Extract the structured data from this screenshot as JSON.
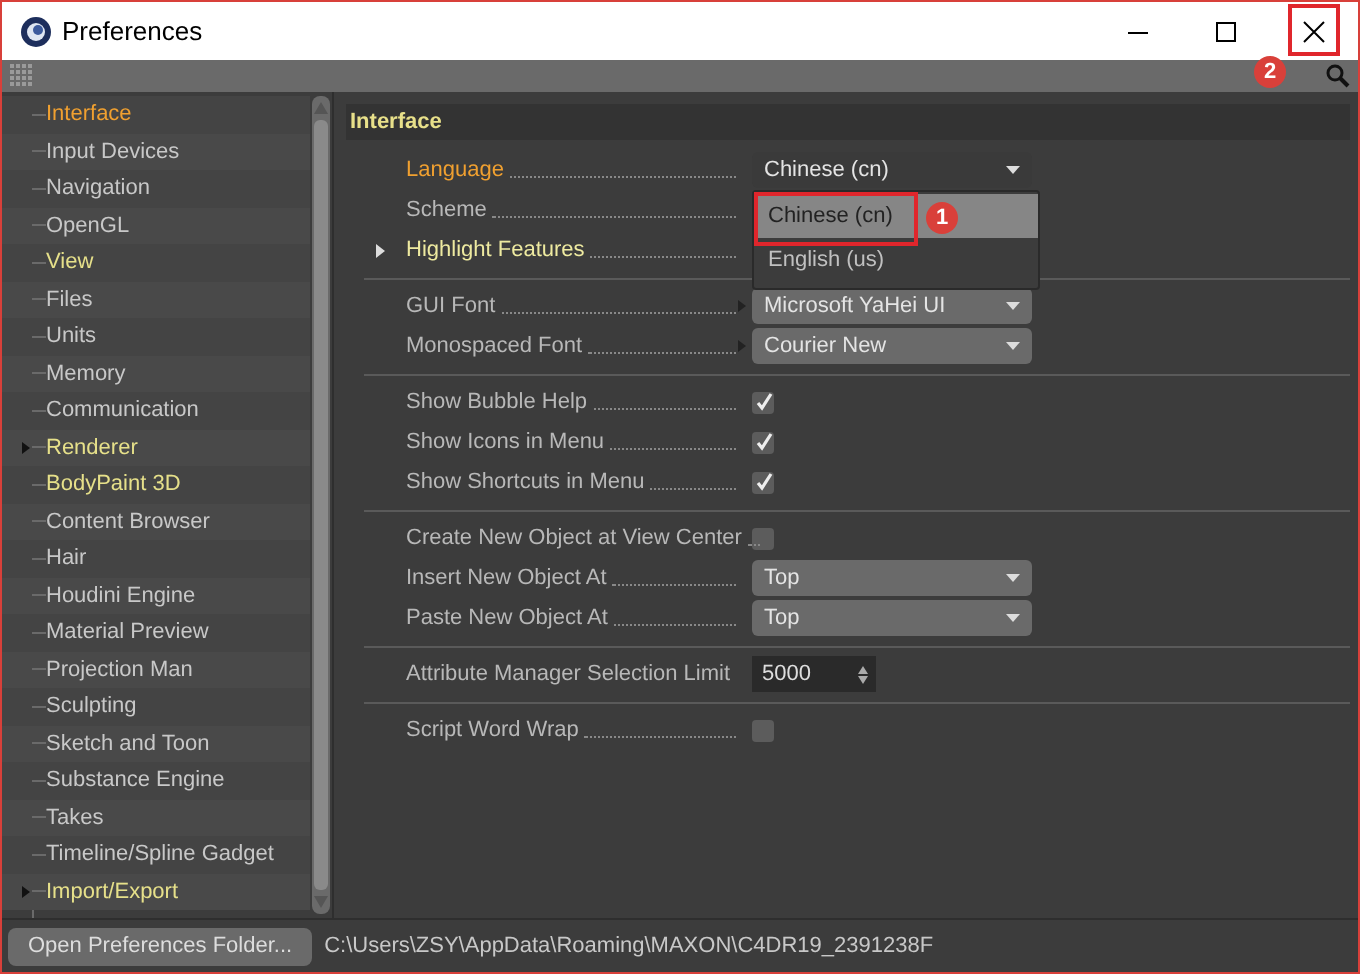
{
  "window": {
    "title": "Preferences"
  },
  "sidebar": {
    "items": [
      {
        "label": "Interface",
        "selected": true,
        "highlighted": false
      },
      {
        "label": "Input Devices",
        "selected": false,
        "highlighted": false
      },
      {
        "label": "Navigation",
        "selected": false,
        "highlighted": false
      },
      {
        "label": "OpenGL",
        "selected": false,
        "highlighted": false
      },
      {
        "label": "View",
        "selected": false,
        "highlighted": true
      },
      {
        "label": "Files",
        "selected": false,
        "highlighted": false
      },
      {
        "label": "Units",
        "selected": false,
        "highlighted": false
      },
      {
        "label": "Memory",
        "selected": false,
        "highlighted": false
      },
      {
        "label": "Communication",
        "selected": false,
        "highlighted": false
      },
      {
        "label": "Renderer",
        "selected": false,
        "highlighted": true,
        "expanded": false
      },
      {
        "label": "BodyPaint 3D",
        "selected": false,
        "highlighted": true
      },
      {
        "label": "Content Browser",
        "selected": false,
        "highlighted": false
      },
      {
        "label": "Hair",
        "selected": false,
        "highlighted": false
      },
      {
        "label": "Houdini Engine",
        "selected": false,
        "highlighted": false
      },
      {
        "label": "Material Preview",
        "selected": false,
        "highlighted": false
      },
      {
        "label": "Projection Man",
        "selected": false,
        "highlighted": false
      },
      {
        "label": "Sculpting",
        "selected": false,
        "highlighted": false
      },
      {
        "label": "Sketch and Toon",
        "selected": false,
        "highlighted": false
      },
      {
        "label": "Substance Engine",
        "selected": false,
        "highlighted": false
      },
      {
        "label": "Takes",
        "selected": false,
        "highlighted": false
      },
      {
        "label": "Timeline/Spline Gadget",
        "selected": false,
        "highlighted": false
      },
      {
        "label": "Import/Export",
        "selected": false,
        "highlighted": true,
        "expanded": false
      }
    ]
  },
  "panel": {
    "title": "Interface",
    "groups": [
      [
        {
          "kind": "dropdown",
          "label": "Language",
          "highlighted": true,
          "value": "Chinese (cn)",
          "open": true,
          "options": [
            {
              "label": "Chinese (cn)",
              "selected": true
            },
            {
              "label": "English (us)",
              "selected": false
            }
          ]
        },
        {
          "kind": "label",
          "label": "Scheme"
        },
        {
          "kind": "label",
          "label": "Highlight Features",
          "emphasized": true,
          "expanded": false
        }
      ],
      [
        {
          "kind": "dropdown",
          "label": "GUI Font",
          "value": "Microsoft YaHei UI",
          "open": false,
          "linked": true
        },
        {
          "kind": "dropdown",
          "label": "Monospaced Font",
          "value": "Courier New",
          "open": false,
          "linked": true
        }
      ],
      [
        {
          "kind": "checkbox",
          "label": "Show Bubble Help",
          "checked": true
        },
        {
          "kind": "checkbox",
          "label": "Show Icons in Menu",
          "checked": true
        },
        {
          "kind": "checkbox",
          "label": "Show Shortcuts in Menu",
          "checked": true
        }
      ],
      [
        {
          "kind": "checkbox",
          "label": "Create New Object at View Center",
          "checked": false
        },
        {
          "kind": "dropdown",
          "label": "Insert New Object At",
          "value": "Top",
          "open": false
        },
        {
          "kind": "dropdown",
          "label": "Paste New Object At",
          "value": "Top",
          "open": false
        }
      ],
      [
        {
          "kind": "number",
          "label": "Attribute Manager Selection Limit",
          "value": "5000"
        }
      ],
      [
        {
          "kind": "checkbox",
          "label": "Script Word Wrap",
          "checked": false
        }
      ]
    ]
  },
  "footer": {
    "button": "Open Preferences Folder...",
    "path": "C:\\Users\\ZSY\\AppData\\Roaming\\MAXON\\C4DR19_2391238F"
  },
  "annotations": [
    {
      "number": "1"
    },
    {
      "number": "2"
    }
  ]
}
